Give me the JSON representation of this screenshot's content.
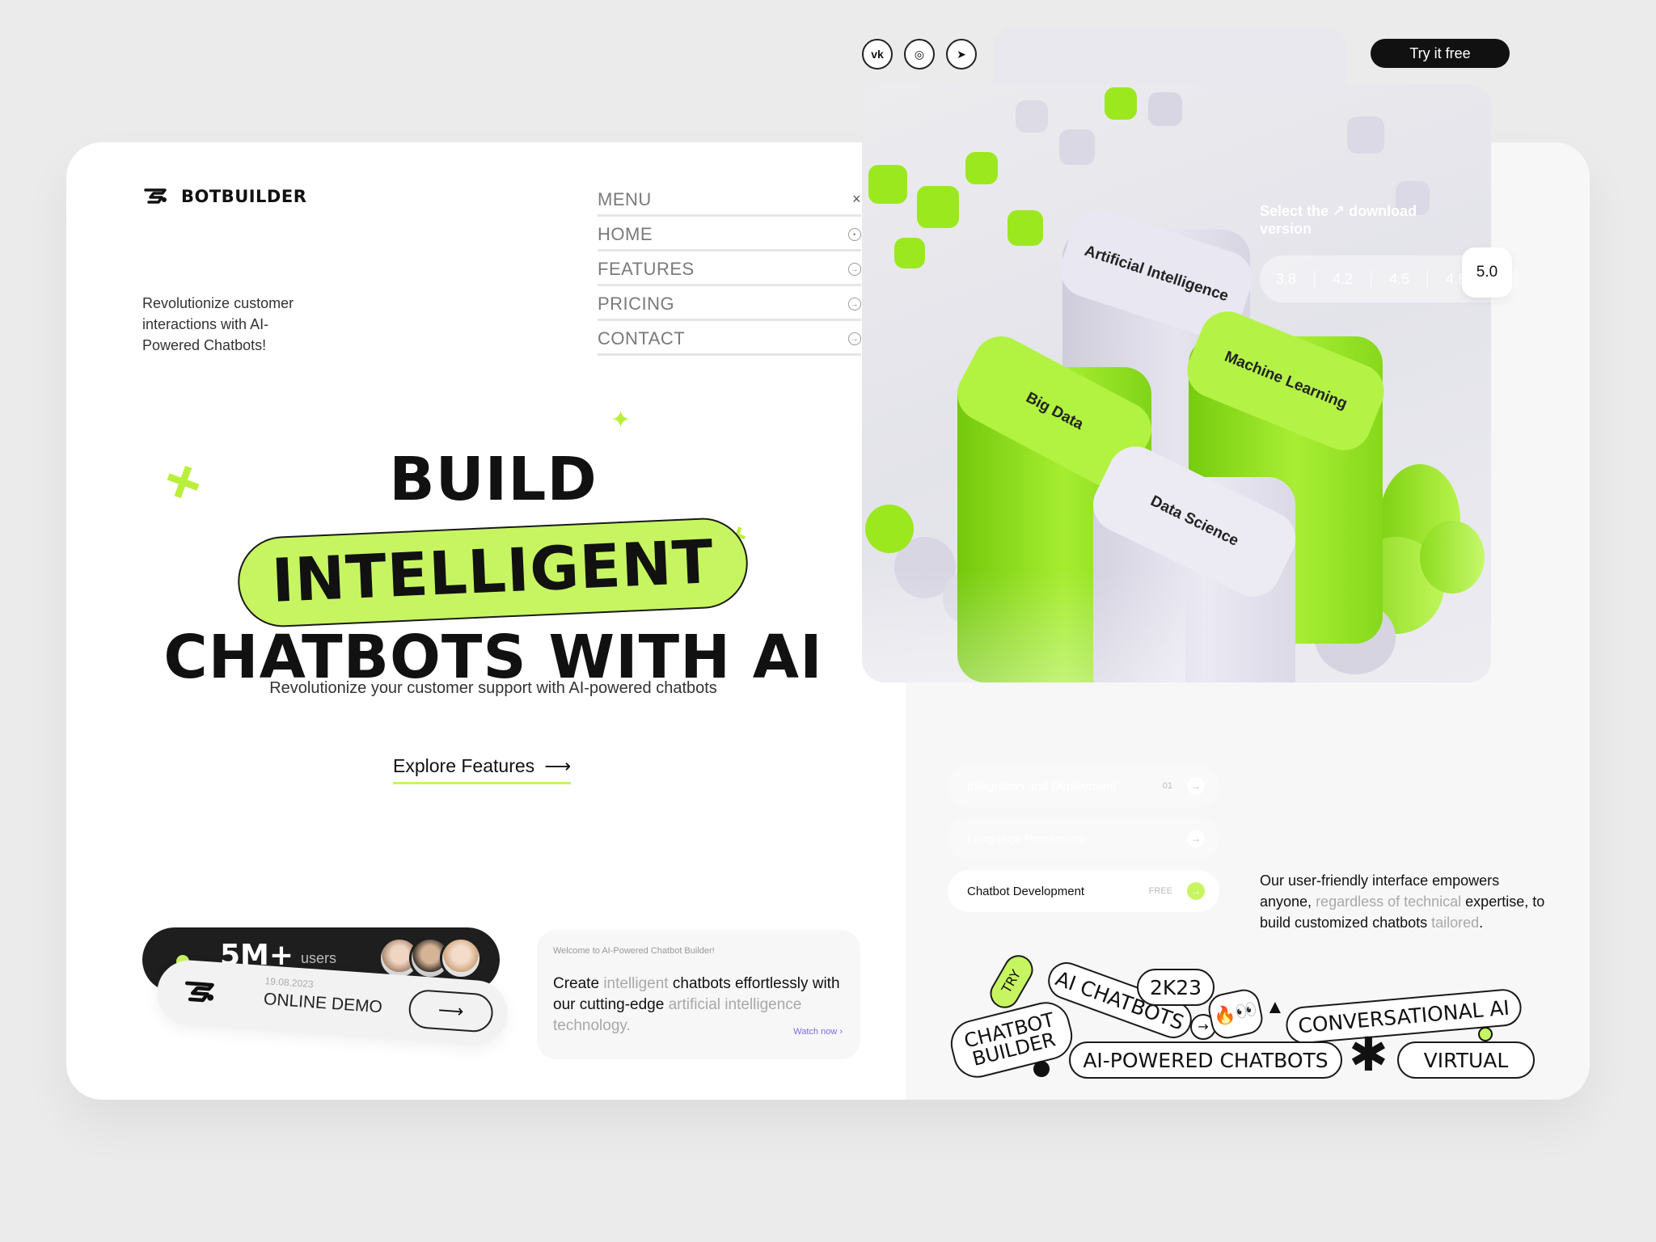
{
  "brand": {
    "name": "BOTBUILDER"
  },
  "tagline": "Revolutionize customer interactions with AI-Powered Chatbots!",
  "menu": {
    "title": "MENU",
    "close": "×",
    "items": [
      {
        "label": "HOME"
      },
      {
        "label": "FEATURES"
      },
      {
        "label": "PRICING"
      },
      {
        "label": "CONTACT"
      }
    ]
  },
  "hero": {
    "line1": "BUILD",
    "line2": "INTELLIGENT",
    "line3": "CHATBOTS WITH AI",
    "subtitle": "Revolutionize your customer support with AI-powered chatbots",
    "cta": "Explore Features",
    "cta_arrow": "⟶"
  },
  "stats": {
    "count": "5M+",
    "label": "users"
  },
  "demo": {
    "date": "19.08.2023",
    "label": "ONLINE DEMO",
    "arrow": "⟶"
  },
  "welcome": {
    "small": "Welcome to AI-Powered Chatbot Builder!",
    "t1": "Create ",
    "t2": "intelligent",
    "t3": " chatbots effortlessly with our cutting-edge ",
    "t4": "artificial intelligence technology.",
    "watch": "Watch now  ›"
  },
  "socials": [
    {
      "icon": "vk-icon",
      "glyph": "vk"
    },
    {
      "icon": "instagram-icon",
      "glyph": "◎"
    },
    {
      "icon": "telegram-icon",
      "glyph": "➤"
    }
  ],
  "try_btn": "Try it free",
  "download": {
    "text": "Select the ↗ download version",
    "versions": [
      "3.8",
      "4.2",
      "4.5",
      "4.8"
    ],
    "active": "5.0"
  },
  "towers": {
    "ai": "Artificial Intelligence",
    "ml": "Machine Learning",
    "bd": "Big Data",
    "ds": "Data Science"
  },
  "chips": [
    {
      "label": "Integration and Deployment",
      "tag": "01",
      "arrow": "→"
    },
    {
      "label": "Language Processing",
      "tag": "",
      "arrow": "→"
    },
    {
      "label": "Chatbot Development",
      "tag": "FREE",
      "arrow": "→"
    }
  ],
  "friendly": {
    "a": "Our user-friendly interface empowers anyone, ",
    "b": "regardless of technical",
    "c": " expertise, to build customized chatbots ",
    "d": "tailored",
    "e": "."
  },
  "stickers": {
    "try": "TRY",
    "ai_chatbots": "AI CHATBOTS",
    "year": "2K23",
    "chatbot_builder_1": "CHATBOT",
    "chatbot_builder_2": "BUILDER",
    "conversational": "CONVERSATIONAL AI",
    "powered": "AI-POWERED CHATBOTS",
    "virtual": "VIRTUAL",
    "asterisk": "✱",
    "arrow": "→",
    "triangle": "▲",
    "emoji": "🔥👀"
  },
  "colors": {
    "accent": "#c7f561",
    "dark": "#111111",
    "lavender": "#e2e0ee"
  }
}
